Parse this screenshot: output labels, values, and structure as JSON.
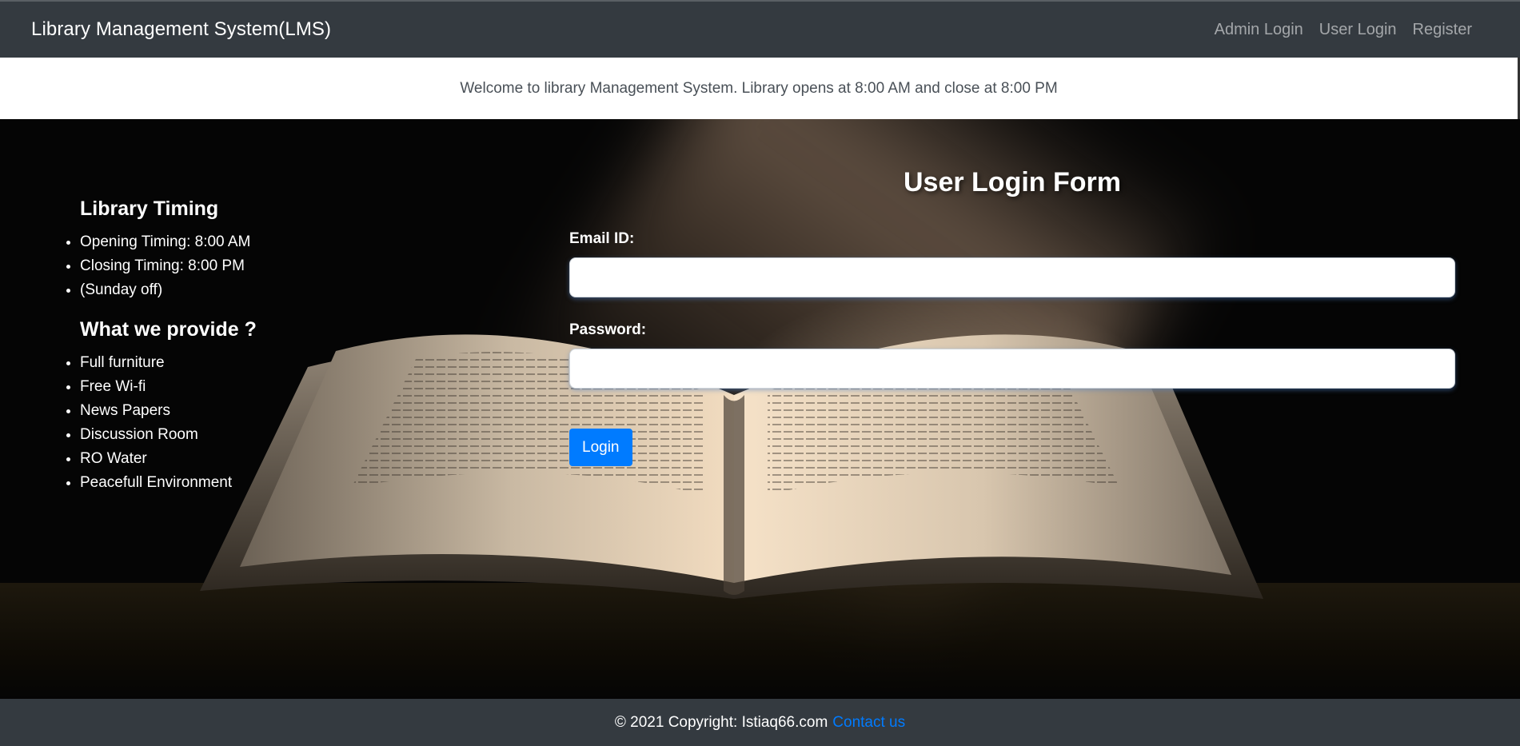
{
  "navbar": {
    "brand": "Library Management System(LMS)",
    "links": [
      {
        "label": "Admin Login"
      },
      {
        "label": "User Login"
      },
      {
        "label": "Register"
      }
    ]
  },
  "welcome": {
    "text": "Welcome to library Management System. Library opens at 8:00 AM and close at 8:00 PM"
  },
  "info": {
    "timing_title": "Library Timing",
    "timing_items": [
      "Opening Timing: 8:00 AM",
      "Closing Timing: 8:00 PM",
      "(Sunday off)"
    ],
    "provide_title": "What we provide ?",
    "provide_items": [
      "Full furniture",
      "Free Wi-fi",
      "News Papers",
      "Discussion Room",
      "RO Water",
      "Peacefull Environment"
    ]
  },
  "form": {
    "title": "User Login Form",
    "email_label": "Email ID:",
    "email_value": "",
    "email_placeholder": "",
    "password_label": "Password:",
    "password_value": "",
    "password_placeholder": "",
    "submit_label": "Login"
  },
  "footer": {
    "copyright": "© 2021 Copyright: Istiaq66.com",
    "contact_label": "Contact us"
  },
  "colors": {
    "navbar_bg": "#343a40",
    "primary": "#007bff",
    "welcome_text": "#495057"
  }
}
